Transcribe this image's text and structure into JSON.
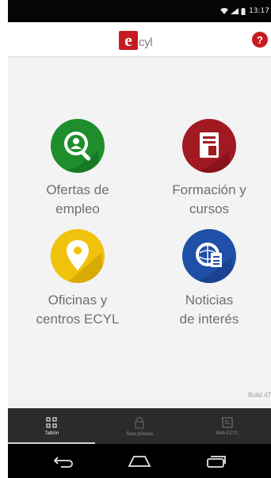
{
  "status_bar": {
    "time": "13:17"
  },
  "app_bar": {
    "logo_letter": "e",
    "logo_text": "cyl",
    "help_label": "?"
  },
  "tiles": [
    {
      "label": "Ofertas de\nempleo",
      "icon": "job-search-icon",
      "color": "#1e8e2c"
    },
    {
      "label": "Formación y\ncursos",
      "icon": "training-document-icon",
      "color": "#a11a22"
    },
    {
      "label": "Oficinas y\ncentros ECYL",
      "icon": "location-pin-icon",
      "color": "#f1c20c"
    },
    {
      "label": "Noticias\nde interés",
      "icon": "news-globe-icon",
      "color": "#1f4fa7"
    }
  ],
  "build": {
    "text": "Build 47"
  },
  "tabs": [
    {
      "label": "Tablón",
      "icon": "grid-icon",
      "active": true
    },
    {
      "label": "Área privada",
      "icon": "lock-icon",
      "active": false
    },
    {
      "label": "Web ECYL",
      "icon": "web-icon",
      "active": false
    }
  ],
  "nav": [
    "back-icon",
    "home-icon",
    "recents-icon"
  ]
}
